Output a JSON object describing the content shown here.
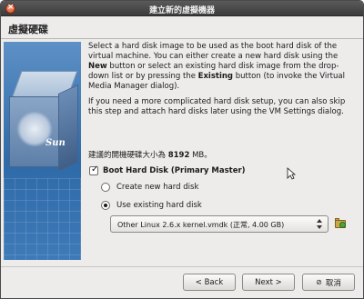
{
  "window": {
    "title": "建立新的虛擬機器"
  },
  "header": {
    "title": "虛擬硬碟"
  },
  "side_logo": "Sun",
  "paragraphs": {
    "p1_a": "Select a hard disk image to be used as the boot hard disk of the virtual machine. You can either create a new hard disk using the ",
    "p1_new": "New",
    "p1_b": " button or select an existing hard disk image from the drop-down list or by pressing the ",
    "p1_existing": "Existing",
    "p1_c": " button (to invoke the Virtual Media Manager dialog).",
    "p2": "If you need a more complicated hard disk setup, you can also skip this step and attach hard disks later using the VM Settings dialog."
  },
  "recommend": {
    "prefix": "建議的開機硬碟大小為 ",
    "size": "8192",
    "suffix": " MB。"
  },
  "boot_disk": {
    "label": "Boot Hard Disk (Primary Master)",
    "checked": true
  },
  "options": {
    "create_label": "Create new hard disk",
    "existing_label": "Use existing hard disk",
    "selected": "existing"
  },
  "combo": {
    "value": "Other Linux 2.6.x kernel.vmdk (正常, 4.00 GB)"
  },
  "buttons": {
    "back": "< Back",
    "next": "Next >",
    "cancel": "取消"
  },
  "icons": {
    "close": "close-icon",
    "folder": "folder-add-icon",
    "cancel": "cancel-icon"
  },
  "colors": {
    "titlebar": "#3c3c3c",
    "side_image": "#2f6aa8",
    "window_bg": "#edeceb"
  }
}
